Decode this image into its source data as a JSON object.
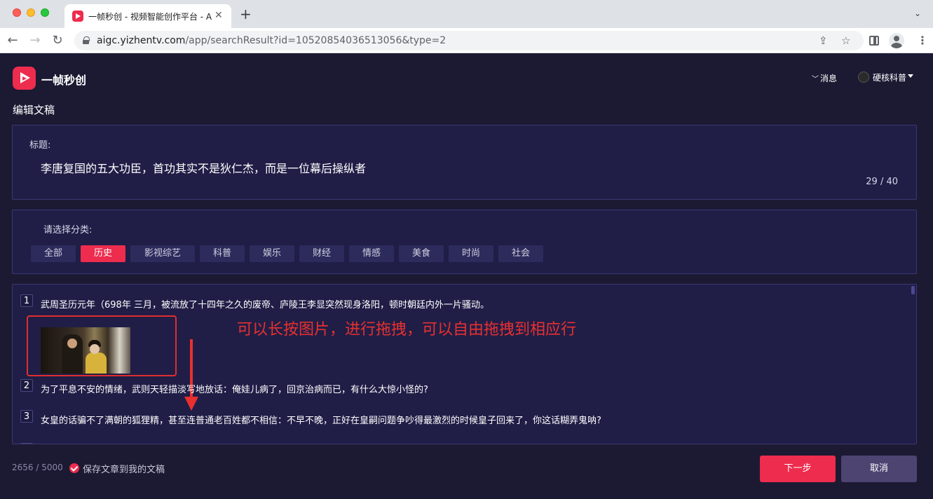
{
  "browser": {
    "tab_title": "一帧秒创 - 视频智能创作平台 - A",
    "url_host": "aigc.yizhentv.com",
    "url_path": "/app/searchResult?id=10520854036513056&type=2",
    "tab_close": "✕",
    "new_tab": "+",
    "tabs_menu": "⌄",
    "icons": {
      "back": "arrow-left-icon",
      "forward": "arrow-right-icon",
      "reload": "reload-icon",
      "share": "share-icon",
      "bookmark": "star-icon",
      "side_panel": "side-panel-icon",
      "profile": "profile-icon",
      "menu": "kebab-menu-icon"
    }
  },
  "header": {
    "brand": "一帧秒创",
    "messages": "消息",
    "user": "硬核科普"
  },
  "page_title": "编辑文稿",
  "title_field": {
    "label": "标题:",
    "value": "李唐复国的五大功臣，首功其实不是狄仁杰，而是一位幕后操纵者",
    "counter": "29 / 40"
  },
  "category": {
    "label": "请选择分类:",
    "options": [
      "全部",
      "历史",
      "影视综艺",
      "科普",
      "娱乐",
      "财经",
      "情感",
      "美食",
      "时尚",
      "社会"
    ],
    "selected": "历史"
  },
  "script_lines": [
    {
      "number": "1",
      "text": "武周圣历元年（698年 三月，被流放了十四年之久的废帝、庐陵王李显突然现身洛阳，顿时朝廷内外一片骚动。"
    },
    {
      "number": "2",
      "text": "为了平息不安的情绪，武则天轻描淡写地放话：俺娃儿病了，回京治病而已，有什么大惊小怪的?"
    },
    {
      "number": "3",
      "text": "女皇的话骗不了满朝的狐狸精，甚至连普通老百姓都不相信：不早不晚，正好在皇嗣问题争吵得最激烈的时候皇子回来了，你这话糊弄鬼呐?"
    }
  ],
  "annotation": "可以长按图片，进行拖拽，可以自由拖拽到相应行",
  "footer": {
    "char_count": "2656 / 5000",
    "save_label": "保存文章到我的文稿",
    "next_button": "下一步",
    "cancel_button": "取消"
  },
  "colors": {
    "accent": "#ed2c4e",
    "page_bg": "#1c1a33",
    "panel_bg": "#201e47",
    "annotation": "#e8302f"
  }
}
